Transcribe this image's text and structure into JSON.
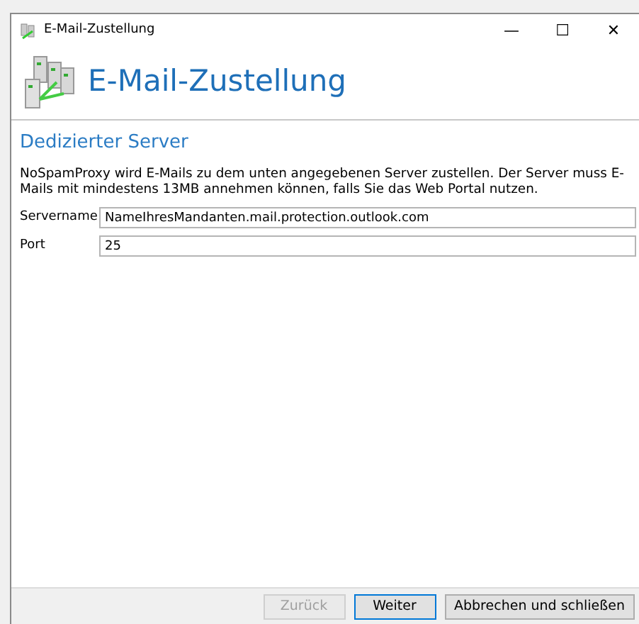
{
  "window": {
    "title": "E-Mail-Zustellung",
    "controls": [
      "—",
      "☐",
      "✕"
    ]
  },
  "header": {
    "title": "E-Mail-Zustellung"
  },
  "section": {
    "title": "Dedizierter Server",
    "description": "NoSpamProxy wird E-Mails zu dem unten angegebenen Server zustellen. Der Server muss E-Mails mit mindestens 13MB annehmen können, falls Sie das Web Portal nutzen."
  },
  "fields": [
    {
      "label": "Servername",
      "value": "NameIhresMandanten.mail.protection.outlook.com"
    },
    {
      "label": "Port",
      "value": "25"
    }
  ],
  "buttons": [
    {
      "label": "Zurück",
      "disabled": true,
      "focused": false
    },
    {
      "label": "Weiter",
      "disabled": false,
      "focused": true
    },
    {
      "label": "Abbrechen und schließen",
      "disabled": false,
      "focused": false
    }
  ]
}
